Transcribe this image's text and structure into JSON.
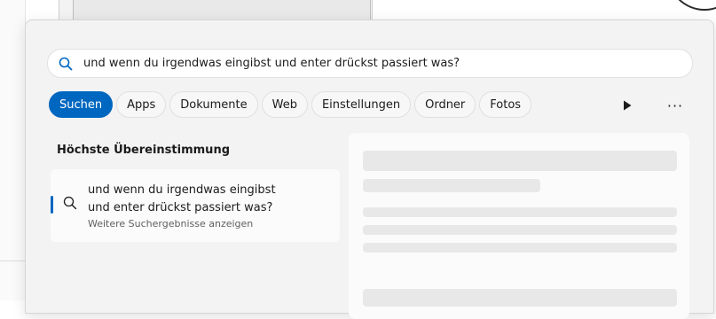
{
  "search": {
    "query": "und wenn du irgendwas eingibst und enter drückst passiert was?",
    "icon": "search-icon"
  },
  "filters": [
    {
      "label": "Suchen",
      "active": true
    },
    {
      "label": "Apps",
      "active": false
    },
    {
      "label": "Dokumente",
      "active": false
    },
    {
      "label": "Web",
      "active": false
    },
    {
      "label": "Einstellungen",
      "active": false
    },
    {
      "label": "Ordner",
      "active": false
    },
    {
      "label": "Fotos",
      "active": false
    }
  ],
  "toolbar": {
    "more_label": "···"
  },
  "best_match": {
    "heading": "Höchste Übereinstimmung",
    "title_line1": "und wenn du irgendwas eingibst",
    "title_line2": "und enter drückst passiert was?",
    "subtitle": "Weitere Suchergebnisse anzeigen"
  },
  "colors": {
    "accent": "#0067c0",
    "panel_bg": "#f3f3f3",
    "skeleton": "#e8e8e8"
  }
}
